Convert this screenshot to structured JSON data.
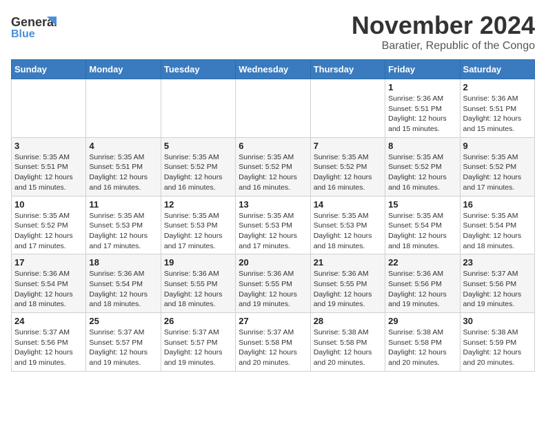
{
  "header": {
    "logo_line1": "General",
    "logo_line2": "Blue",
    "month_title": "November 2024",
    "location": "Baratier, Republic of the Congo"
  },
  "days_of_week": [
    "Sunday",
    "Monday",
    "Tuesday",
    "Wednesday",
    "Thursday",
    "Friday",
    "Saturday"
  ],
  "weeks": [
    [
      {
        "day": "",
        "info": ""
      },
      {
        "day": "",
        "info": ""
      },
      {
        "day": "",
        "info": ""
      },
      {
        "day": "",
        "info": ""
      },
      {
        "day": "",
        "info": ""
      },
      {
        "day": "1",
        "info": "Sunrise: 5:36 AM\nSunset: 5:51 PM\nDaylight: 12 hours and 15 minutes."
      },
      {
        "day": "2",
        "info": "Sunrise: 5:36 AM\nSunset: 5:51 PM\nDaylight: 12 hours and 15 minutes."
      }
    ],
    [
      {
        "day": "3",
        "info": "Sunrise: 5:35 AM\nSunset: 5:51 PM\nDaylight: 12 hours and 15 minutes."
      },
      {
        "day": "4",
        "info": "Sunrise: 5:35 AM\nSunset: 5:51 PM\nDaylight: 12 hours and 16 minutes."
      },
      {
        "day": "5",
        "info": "Sunrise: 5:35 AM\nSunset: 5:52 PM\nDaylight: 12 hours and 16 minutes."
      },
      {
        "day": "6",
        "info": "Sunrise: 5:35 AM\nSunset: 5:52 PM\nDaylight: 12 hours and 16 minutes."
      },
      {
        "day": "7",
        "info": "Sunrise: 5:35 AM\nSunset: 5:52 PM\nDaylight: 12 hours and 16 minutes."
      },
      {
        "day": "8",
        "info": "Sunrise: 5:35 AM\nSunset: 5:52 PM\nDaylight: 12 hours and 16 minutes."
      },
      {
        "day": "9",
        "info": "Sunrise: 5:35 AM\nSunset: 5:52 PM\nDaylight: 12 hours and 17 minutes."
      }
    ],
    [
      {
        "day": "10",
        "info": "Sunrise: 5:35 AM\nSunset: 5:52 PM\nDaylight: 12 hours and 17 minutes."
      },
      {
        "day": "11",
        "info": "Sunrise: 5:35 AM\nSunset: 5:53 PM\nDaylight: 12 hours and 17 minutes."
      },
      {
        "day": "12",
        "info": "Sunrise: 5:35 AM\nSunset: 5:53 PM\nDaylight: 12 hours and 17 minutes."
      },
      {
        "day": "13",
        "info": "Sunrise: 5:35 AM\nSunset: 5:53 PM\nDaylight: 12 hours and 17 minutes."
      },
      {
        "day": "14",
        "info": "Sunrise: 5:35 AM\nSunset: 5:53 PM\nDaylight: 12 hours and 18 minutes."
      },
      {
        "day": "15",
        "info": "Sunrise: 5:35 AM\nSunset: 5:54 PM\nDaylight: 12 hours and 18 minutes."
      },
      {
        "day": "16",
        "info": "Sunrise: 5:35 AM\nSunset: 5:54 PM\nDaylight: 12 hours and 18 minutes."
      }
    ],
    [
      {
        "day": "17",
        "info": "Sunrise: 5:36 AM\nSunset: 5:54 PM\nDaylight: 12 hours and 18 minutes."
      },
      {
        "day": "18",
        "info": "Sunrise: 5:36 AM\nSunset: 5:54 PM\nDaylight: 12 hours and 18 minutes."
      },
      {
        "day": "19",
        "info": "Sunrise: 5:36 AM\nSunset: 5:55 PM\nDaylight: 12 hours and 18 minutes."
      },
      {
        "day": "20",
        "info": "Sunrise: 5:36 AM\nSunset: 5:55 PM\nDaylight: 12 hours and 19 minutes."
      },
      {
        "day": "21",
        "info": "Sunrise: 5:36 AM\nSunset: 5:55 PM\nDaylight: 12 hours and 19 minutes."
      },
      {
        "day": "22",
        "info": "Sunrise: 5:36 AM\nSunset: 5:56 PM\nDaylight: 12 hours and 19 minutes."
      },
      {
        "day": "23",
        "info": "Sunrise: 5:37 AM\nSunset: 5:56 PM\nDaylight: 12 hours and 19 minutes."
      }
    ],
    [
      {
        "day": "24",
        "info": "Sunrise: 5:37 AM\nSunset: 5:56 PM\nDaylight: 12 hours and 19 minutes."
      },
      {
        "day": "25",
        "info": "Sunrise: 5:37 AM\nSunset: 5:57 PM\nDaylight: 12 hours and 19 minutes."
      },
      {
        "day": "26",
        "info": "Sunrise: 5:37 AM\nSunset: 5:57 PM\nDaylight: 12 hours and 19 minutes."
      },
      {
        "day": "27",
        "info": "Sunrise: 5:37 AM\nSunset: 5:58 PM\nDaylight: 12 hours and 20 minutes."
      },
      {
        "day": "28",
        "info": "Sunrise: 5:38 AM\nSunset: 5:58 PM\nDaylight: 12 hours and 20 minutes."
      },
      {
        "day": "29",
        "info": "Sunrise: 5:38 AM\nSunset: 5:58 PM\nDaylight: 12 hours and 20 minutes."
      },
      {
        "day": "30",
        "info": "Sunrise: 5:38 AM\nSunset: 5:59 PM\nDaylight: 12 hours and 20 minutes."
      }
    ]
  ]
}
